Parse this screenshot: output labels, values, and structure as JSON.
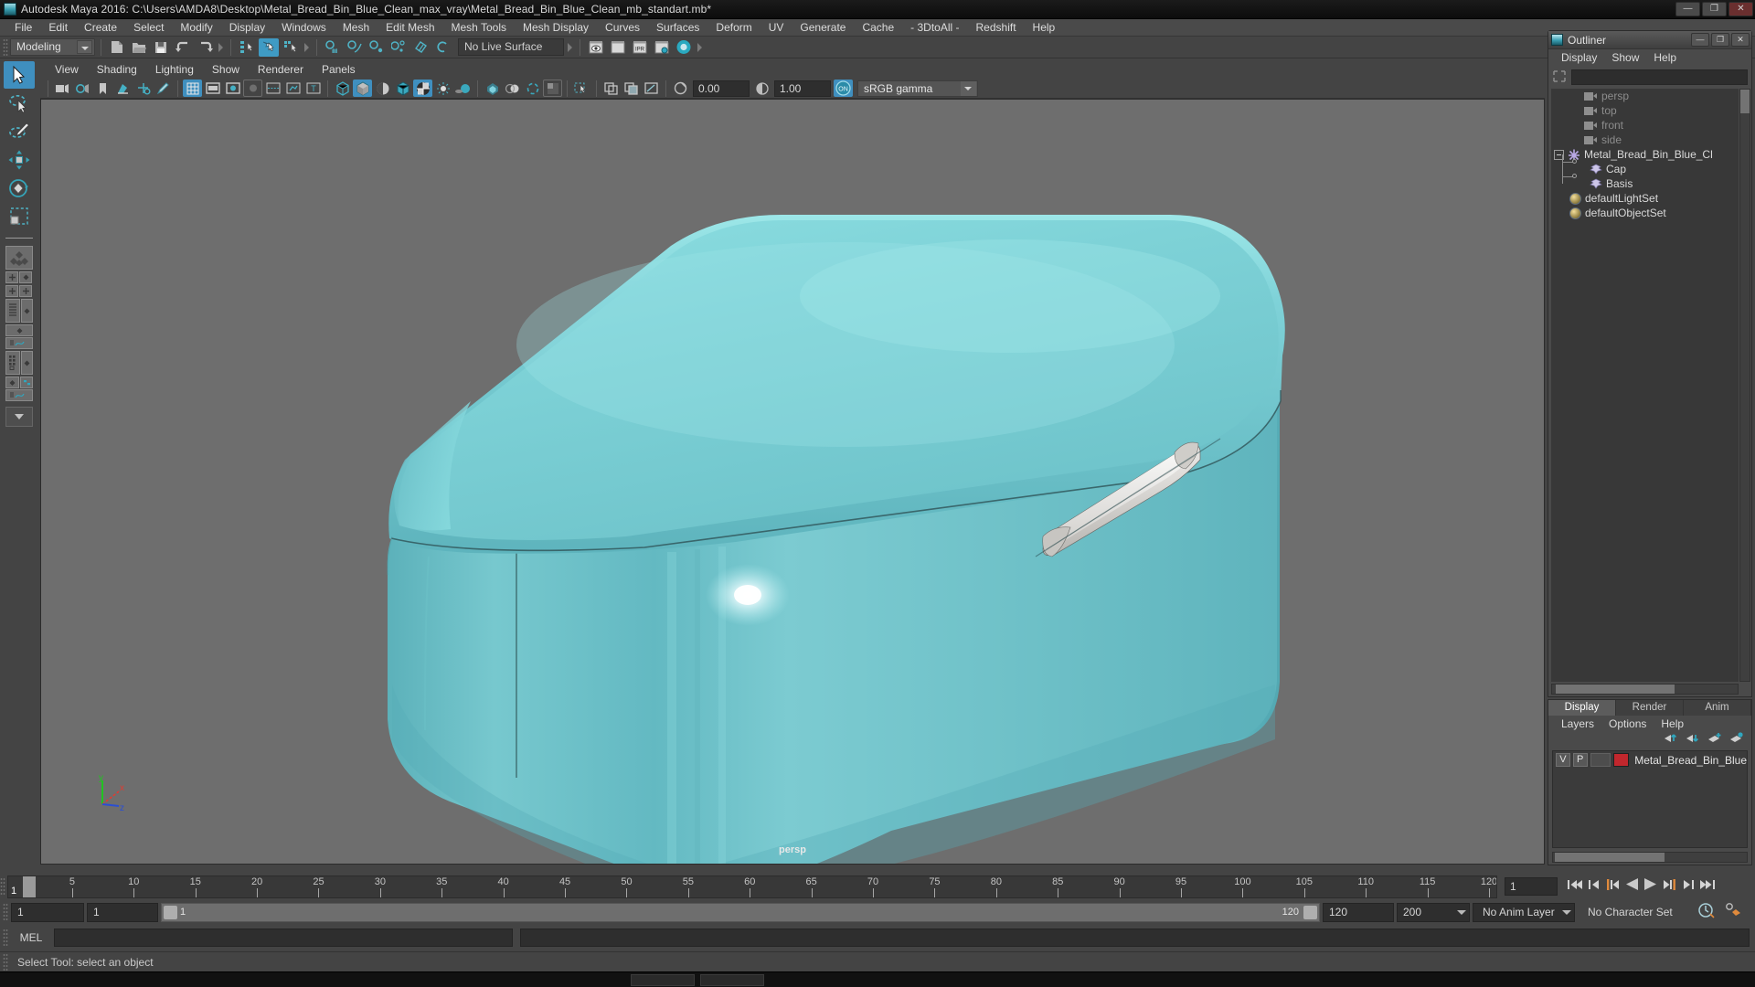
{
  "window": {
    "title": "Autodesk Maya 2016: C:\\Users\\AMDA8\\Desktop\\Metal_Bread_Bin_Blue_Clean_max_vray\\Metal_Bread_Bin_Blue_Clean_mb_standart.mb*",
    "minimize_label": "—",
    "maximize_label": "❐",
    "close_label": "✕",
    "app_icon": "maya-icon"
  },
  "menu": {
    "items": [
      "File",
      "Edit",
      "Create",
      "Select",
      "Modify",
      "Display",
      "Windows",
      "Mesh",
      "Edit Mesh",
      "Mesh Tools",
      "Mesh Display",
      "Curves",
      "Surfaces",
      "Deform",
      "UV",
      "Generate",
      "Cache",
      "- 3DtoAll -",
      "Redshift",
      "Help"
    ]
  },
  "status_line": {
    "menu_set": "Modeling",
    "live_surface": "No Live Surface",
    "icons": [
      "new-scene-icon",
      "open-scene-icon",
      "save-scene-icon",
      "undo-icon",
      "redo-icon",
      "select-by-hierarchy-icon",
      "select-by-object-icon",
      "select-by-component-icon",
      "snap-to-grid-icon",
      "snap-to-curve-icon",
      "snap-to-point-icon",
      "snap-to-projected-center-icon",
      "snap-to-view-plane-icon",
      "make-live-icon",
      "render-current-frame-icon",
      "render-sequence-icon",
      "ipr-render-icon",
      "render-settings-icon",
      "hypershade-icon"
    ]
  },
  "toolbox": {
    "items": [
      {
        "name": "select-tool",
        "active": true
      },
      {
        "name": "lasso-select-tool",
        "active": false
      },
      {
        "name": "paint-select-tool",
        "active": false
      },
      {
        "name": "move-tool",
        "active": false
      },
      {
        "name": "rotate-tool",
        "active": false
      },
      {
        "name": "scale-tool",
        "active": false
      },
      {
        "name": "last-tool-used",
        "active": false
      },
      {
        "name": "single-perspective-layout",
        "active": false
      },
      {
        "name": "four-view-layout",
        "active": false
      },
      {
        "name": "outliner-persp-layout",
        "active": false
      },
      {
        "name": "persp-graph-layout",
        "active": false
      },
      {
        "name": "hypershade-persp-layout",
        "active": false
      },
      {
        "name": "persp-graph-hypergraph-layout",
        "active": false
      },
      {
        "name": "layout-more-dropdown",
        "active": false
      }
    ]
  },
  "viewport": {
    "menus": [
      "View",
      "Shading",
      "Lighting",
      "Show",
      "Renderer",
      "Panels"
    ],
    "camera_label": "persp",
    "exposure_value": "0.00",
    "gamma_value": "1.00",
    "color_management": "sRGB gamma",
    "background_color": "#6e6e6e",
    "model_color": "#76cdd2",
    "handle_color": "#d6d3d1",
    "axis_labels": [
      "y",
      "x",
      "z"
    ],
    "axis_colors": {
      "x": "#e03c31",
      "y": "#21c421",
      "z": "#2a4fd4"
    },
    "toolbar_icons": [
      "select-camera-icon",
      "camera-attributes-icon",
      "bookmarks-icon",
      "image-plane-icon",
      "two-d-pan-zoom-icon",
      "grease-pencil-icon",
      "grid-icon",
      "film-gate-icon",
      "resolution-gate-icon",
      "gate-mask-icon",
      "film-origin-icon",
      "safe-action-icon",
      "title-safe-icon",
      "wireframe-icon",
      "smooth-shade-all-icon",
      "shade-flat-icon",
      "wireframe-on-shaded-icon",
      "texture-icon",
      "use-default-light-icon",
      "shadows-icon",
      "screen-space-ambient-occlusion-icon",
      "motion-blur-icon",
      "multisample-icon",
      "depth-of-field-icon",
      "isolate-select-icon",
      "xray-icon",
      "xray-joints-icon",
      "xray-active-icon",
      "exposure-icon",
      "gamma-icon",
      "color-management-toggle-icon"
    ]
  },
  "outliner": {
    "title": "Outliner",
    "icon": "maya-icon",
    "window_buttons": [
      "—",
      "❐",
      "✕"
    ],
    "menus": [
      "Display",
      "Show",
      "Help"
    ],
    "search_placeholder": "",
    "search_value": "",
    "search_icon": "filter-icon",
    "items": [
      {
        "label": "persp",
        "icon": "camera-icon",
        "depth": 1,
        "dim": true,
        "expandable": false
      },
      {
        "label": "top",
        "icon": "camera-icon",
        "depth": 1,
        "dim": true,
        "expandable": false
      },
      {
        "label": "front",
        "icon": "camera-icon",
        "depth": 1,
        "dim": true,
        "expandable": false
      },
      {
        "label": "side",
        "icon": "camera-icon",
        "depth": 1,
        "dim": true,
        "expandable": false
      },
      {
        "label": "Metal_Bread_Bin_Blue_Cl",
        "icon": "group-icon",
        "depth": 0,
        "dim": false,
        "expandable": true
      },
      {
        "label": "Cap",
        "icon": "mesh-icon",
        "depth": 1,
        "dim": false,
        "expandable": false
      },
      {
        "label": "Basis",
        "icon": "mesh-icon",
        "depth": 1,
        "dim": false,
        "expandable": false
      },
      {
        "label": "defaultLightSet",
        "icon": "set-icon",
        "depth": 0,
        "dim": false,
        "expandable": false
      },
      {
        "label": "defaultObjectSet",
        "icon": "set-icon",
        "depth": 0,
        "dim": false,
        "expandable": false
      }
    ]
  },
  "layer_editor": {
    "tabs": [
      {
        "label": "Display",
        "active": true
      },
      {
        "label": "Render",
        "active": false
      },
      {
        "label": "Anim",
        "active": false
      }
    ],
    "menus": [
      "Layers",
      "Options",
      "Help"
    ],
    "toolbar_icons": [
      "move-layer-up-icon",
      "move-layer-down-icon",
      "new-layer-icon",
      "new-layer-from-selected-icon"
    ],
    "layers": [
      {
        "visibility": "V",
        "playback": "P",
        "color": "#c1272d",
        "name": "Metal_Bread_Bin_Blue"
      }
    ]
  },
  "time_slider": {
    "tick_labels": [
      "5",
      "10",
      "15",
      "20",
      "25",
      "30",
      "35",
      "40",
      "45",
      "50",
      "55",
      "60",
      "65",
      "70",
      "75",
      "80",
      "85",
      "90",
      "95",
      "100",
      "105",
      "110",
      "115",
      "120"
    ],
    "tick_values": [
      5,
      10,
      15,
      20,
      25,
      30,
      35,
      40,
      45,
      50,
      55,
      60,
      65,
      70,
      75,
      80,
      85,
      90,
      95,
      100,
      105,
      110,
      115,
      120
    ],
    "range_start": 1,
    "range_end": 120,
    "current_frame_label": "1",
    "current_frame_field": "1",
    "playback_buttons": [
      "go-to-start-icon",
      "step-back-frame-icon",
      "step-back-key-icon",
      "play-backwards-icon",
      "play-forwards-icon",
      "step-forward-key-icon",
      "step-forward-frame-icon",
      "go-to-end-icon"
    ]
  },
  "range_slider": {
    "anim_start": "1",
    "range_start": "1",
    "bar_start_label": "1",
    "bar_end_label": "120",
    "range_end": "120",
    "anim_end": "200",
    "anim_layer": "No Anim Layer",
    "character_set": "No Character Set",
    "auto_key_icon": "auto-keyframe-icon",
    "anim_prefs_icon": "animation-preferences-icon"
  },
  "command_line": {
    "language_label": "MEL",
    "input_value": "",
    "output_value": ""
  },
  "help_line": {
    "text": "Select Tool: select an object"
  }
}
